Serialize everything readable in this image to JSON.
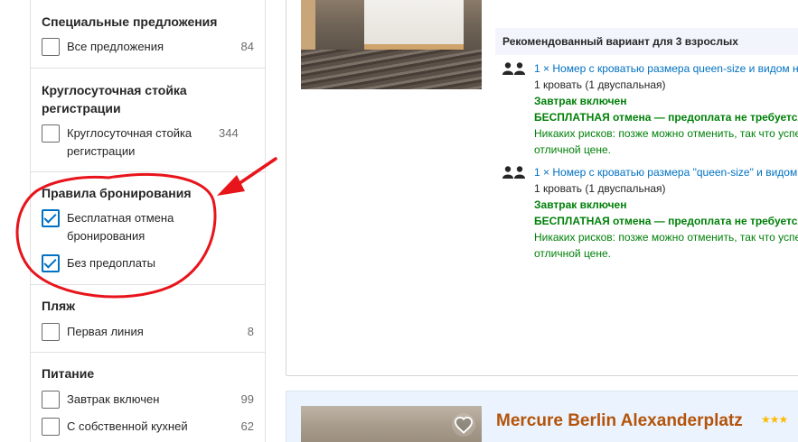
{
  "filters": {
    "special_offers": {
      "title": "Специальные предложения",
      "options": [
        {
          "label": "Все предложения",
          "count": "84",
          "checked": false
        }
      ]
    },
    "reception": {
      "title": "Круглосуточная стойка регистрации",
      "options": [
        {
          "label": "Круглосуточная стойка регистрации",
          "count": "344",
          "checked": false
        }
      ]
    },
    "booking_rules": {
      "title": "Правила бронирования",
      "options": [
        {
          "label": "Бесплатная отмена бронирования",
          "count": "",
          "checked": true
        },
        {
          "label": "Без предоплаты",
          "count": "",
          "checked": true
        }
      ]
    },
    "beach": {
      "title": "Пляж",
      "options": [
        {
          "label": "Первая линия",
          "count": "8",
          "checked": false
        }
      ]
    },
    "meals": {
      "title": "Питание",
      "options": [
        {
          "label": "Завтрак включен",
          "count": "99",
          "checked": false
        },
        {
          "label": "С собственной кухней",
          "count": "62",
          "checked": false
        }
      ]
    }
  },
  "recommendation": {
    "header": "Рекомендованный вариант для 3 взрослых",
    "rooms": [
      {
        "title": "1 × Номер с кроватью размера queen-size и видом на",
        "bed": "1 кровать (1 двуспальная)",
        "breakfast": "Завтрак включен",
        "cancellation": "БЕСПЛАТНАЯ отмена — предоплата не требуется",
        "note_line1": "Никаких рисков: позже можно отменить, так что успе",
        "note_line2": "отличной цене."
      },
      {
        "title": "1 × Номер с кроватью размера \"queen-size\" и видом н",
        "bed": "1 кровать (1 двуспальная)",
        "breakfast": "Завтрак включен",
        "cancellation": "БЕСПЛАТНАЯ отмена — предоплата не требуется",
        "note_line1": "Никаких рисков: позже можно отменить, так что успе",
        "note_line2": "отличной цене."
      }
    ]
  },
  "next_hotel": {
    "name": "Mercure Berlin Alexanderplatz",
    "stars": "★★★"
  },
  "icons": {
    "guests": "two-persons-icon",
    "favorite": "heart-icon",
    "checkmark": "checkmark-icon"
  },
  "colors": {
    "link_blue": "#0071c2",
    "success_green": "#008009",
    "annotation_red": "#e8141b",
    "hotel_name": "#b45309",
    "star_yellow": "#febb02",
    "highlight_bg": "#ebf3ff"
  }
}
